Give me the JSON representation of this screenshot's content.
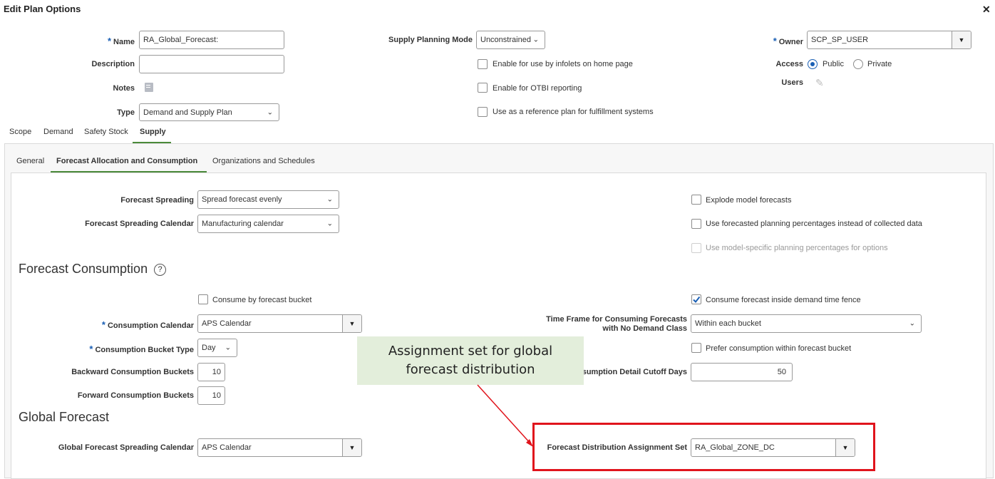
{
  "dialog": {
    "title": "Edit Plan Options",
    "close": "✕"
  },
  "header": {
    "name_label": "Name",
    "name_value": "RA_Global_Forecast:",
    "description_label": "Description",
    "description_value": "",
    "notes_label": "Notes",
    "type_label": "Type",
    "type_value": "Demand and Supply Plan",
    "supply_mode_label": "Supply Planning Mode",
    "supply_mode_value": "Unconstrained",
    "infolets_label": "Enable for use by infolets on home page",
    "otbi_label": "Enable for OTBI reporting",
    "reference_label": "Use as a reference plan for fulfillment systems",
    "owner_label": "Owner",
    "owner_value": "SCP_SP_USER",
    "access_label": "Access",
    "access_public": "Public",
    "access_private": "Private",
    "users_label": "Users"
  },
  "tabs": [
    "Scope",
    "Demand",
    "Safety Stock",
    "Supply"
  ],
  "subtabs": [
    "General",
    "Forecast Allocation and Consumption",
    "Organizations and Schedules"
  ],
  "spreading": {
    "spreading_label": "Forecast Spreading",
    "spreading_value": "Spread forecast evenly",
    "calendar_label": "Forecast Spreading Calendar",
    "calendar_value": "Manufacturing calendar",
    "explode_label": "Explode model forecasts",
    "use_forecasted_label": "Use forecasted planning percentages instead of collected data",
    "use_model_label": "Use model-specific planning percentages for options"
  },
  "consumption": {
    "title": "Forecast Consumption",
    "consume_bucket_label": "Consume by forecast bucket",
    "calendar_label": "Consumption Calendar",
    "calendar_value": "APS Calendar",
    "bucket_type_label": "Consumption Bucket Type",
    "bucket_type_value": "Day",
    "backward_label": "Backward Consumption Buckets",
    "backward_value": "10",
    "forward_label": "Forward Consumption Buckets",
    "forward_value": "10",
    "inside_fence_label": "Consume forecast inside demand time fence",
    "timeframe_label_1": "Time Frame for Consuming Forecasts",
    "timeframe_label_2": "with No Demand Class",
    "timeframe_value": "Within each bucket",
    "prefer_label": "Prefer consumption within forecast bucket",
    "cutoff_label": "sumption Detail Cutoff Days",
    "cutoff_value": "50"
  },
  "global": {
    "title": "Global Forecast",
    "calendar_label": "Global Forecast Spreading Calendar",
    "calendar_value": "APS Calendar",
    "assignment_label": "Forecast Distribution Assignment Set",
    "assignment_value": "RA_Global_ZONE_DC"
  },
  "callout": {
    "line1": "Assignment set for global",
    "line2": "forecast distribution"
  },
  "colors": {
    "accent": "#1a5fb4",
    "tab_underline": "#4a8a3a",
    "callout_bg": "#e3eedb",
    "highlight": "#e0141c"
  }
}
